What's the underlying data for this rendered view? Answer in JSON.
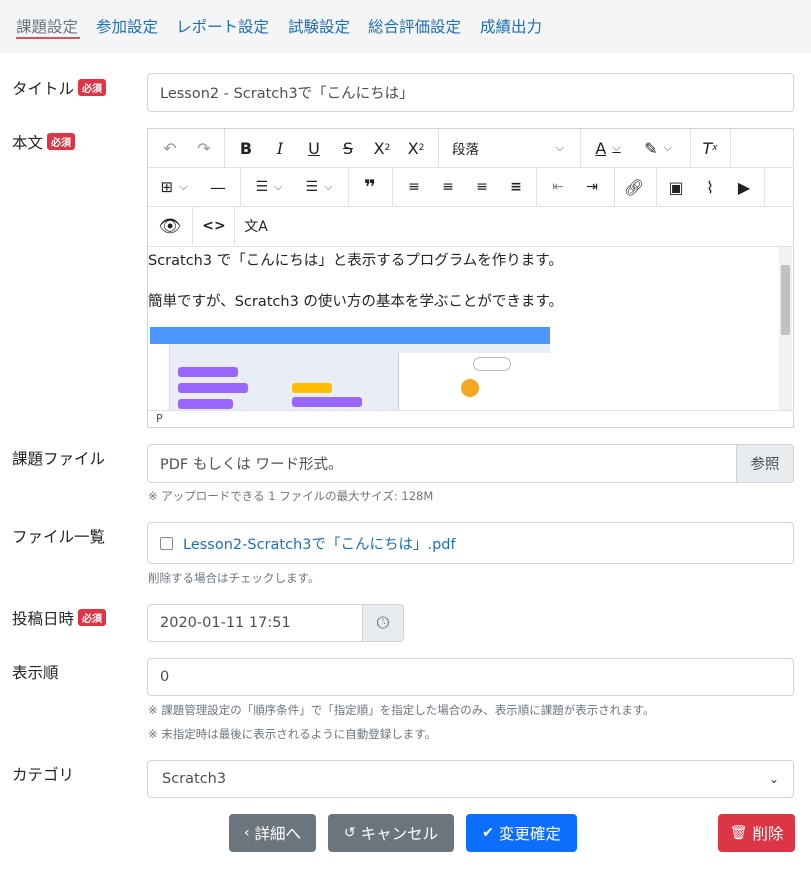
{
  "tabs": [
    {
      "label": "課題設定"
    },
    {
      "label": "参加設定"
    },
    {
      "label": "レポート設定"
    },
    {
      "label": "試験設定"
    },
    {
      "label": "総合評価設定"
    },
    {
      "label": "成績出力"
    }
  ],
  "required_badge": "必須",
  "title_field": {
    "label": "タイトル",
    "value": "Lesson2 - Scratch3で「こんにちは」"
  },
  "body_field": {
    "label": "本文",
    "block_format": "段落",
    "content_lines": [
      "Scratch3 で「こんにちは」と表示するプログラムを作ります。",
      "簡単ですが、Scratch3 の使い方の基本を学ぶことができます。"
    ],
    "status_path": "P"
  },
  "file_field": {
    "label": "課題ファイル",
    "placeholder": "PDF もしくは ワード形式。",
    "browse_label": "参照",
    "help": "※ アップロードできる 1 ファイルの最大サイズ: 128M"
  },
  "file_list": {
    "label": "ファイル一覧",
    "file_name": "Lesson2-Scratch3で「こんにちは」.pdf",
    "help": "削除する場合はチェックします。"
  },
  "post_date": {
    "label": "投稿日時",
    "value": "2020-01-11 17:51"
  },
  "display_order": {
    "label": "表示順",
    "value": "0",
    "help1": "※ 課題管理設定の「順序条件」で「指定順」を指定した場合のみ、表示順に課題が表示されます。",
    "help2": "※ 未指定時は最後に表示されるように自動登録します。"
  },
  "category": {
    "label": "カテゴリ",
    "value": "Scratch3"
  },
  "buttons": {
    "back": "詳細へ",
    "cancel": "キャンセル",
    "confirm": "変更確定",
    "delete": "削除"
  },
  "colors": {
    "link": "#1f6fb5",
    "required": "#dc3545",
    "secondary": "#6c757d",
    "primary": "#0d6efd",
    "danger": "#dc3545"
  }
}
